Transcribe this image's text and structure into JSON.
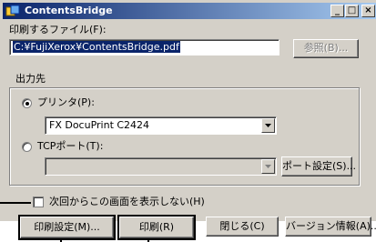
{
  "window": {
    "title": "ContentsBridge",
    "minimize": "_",
    "maximize": "□",
    "close": "×"
  },
  "file": {
    "label": "印刷するファイル(F):",
    "value": "C:¥FujiXerox¥ContentsBridge.pdf",
    "browse_button": "参照(B)..."
  },
  "output": {
    "group_label": "出力先",
    "printer_radio": "プリンタ(P):",
    "printer_value": "FX DocuPrint C2424",
    "tcp_radio": "TCPポート(T):",
    "tcp_value": "",
    "port_settings_button": "ポート設定(S)..."
  },
  "checkbox": {
    "label": "次回からこの画面を表示しない(H)"
  },
  "buttons": {
    "print_settings": "印刷設定(M)...",
    "print": "印刷(R)",
    "close": "閉じる(C)",
    "version": "バージョン情報(A)..."
  }
}
